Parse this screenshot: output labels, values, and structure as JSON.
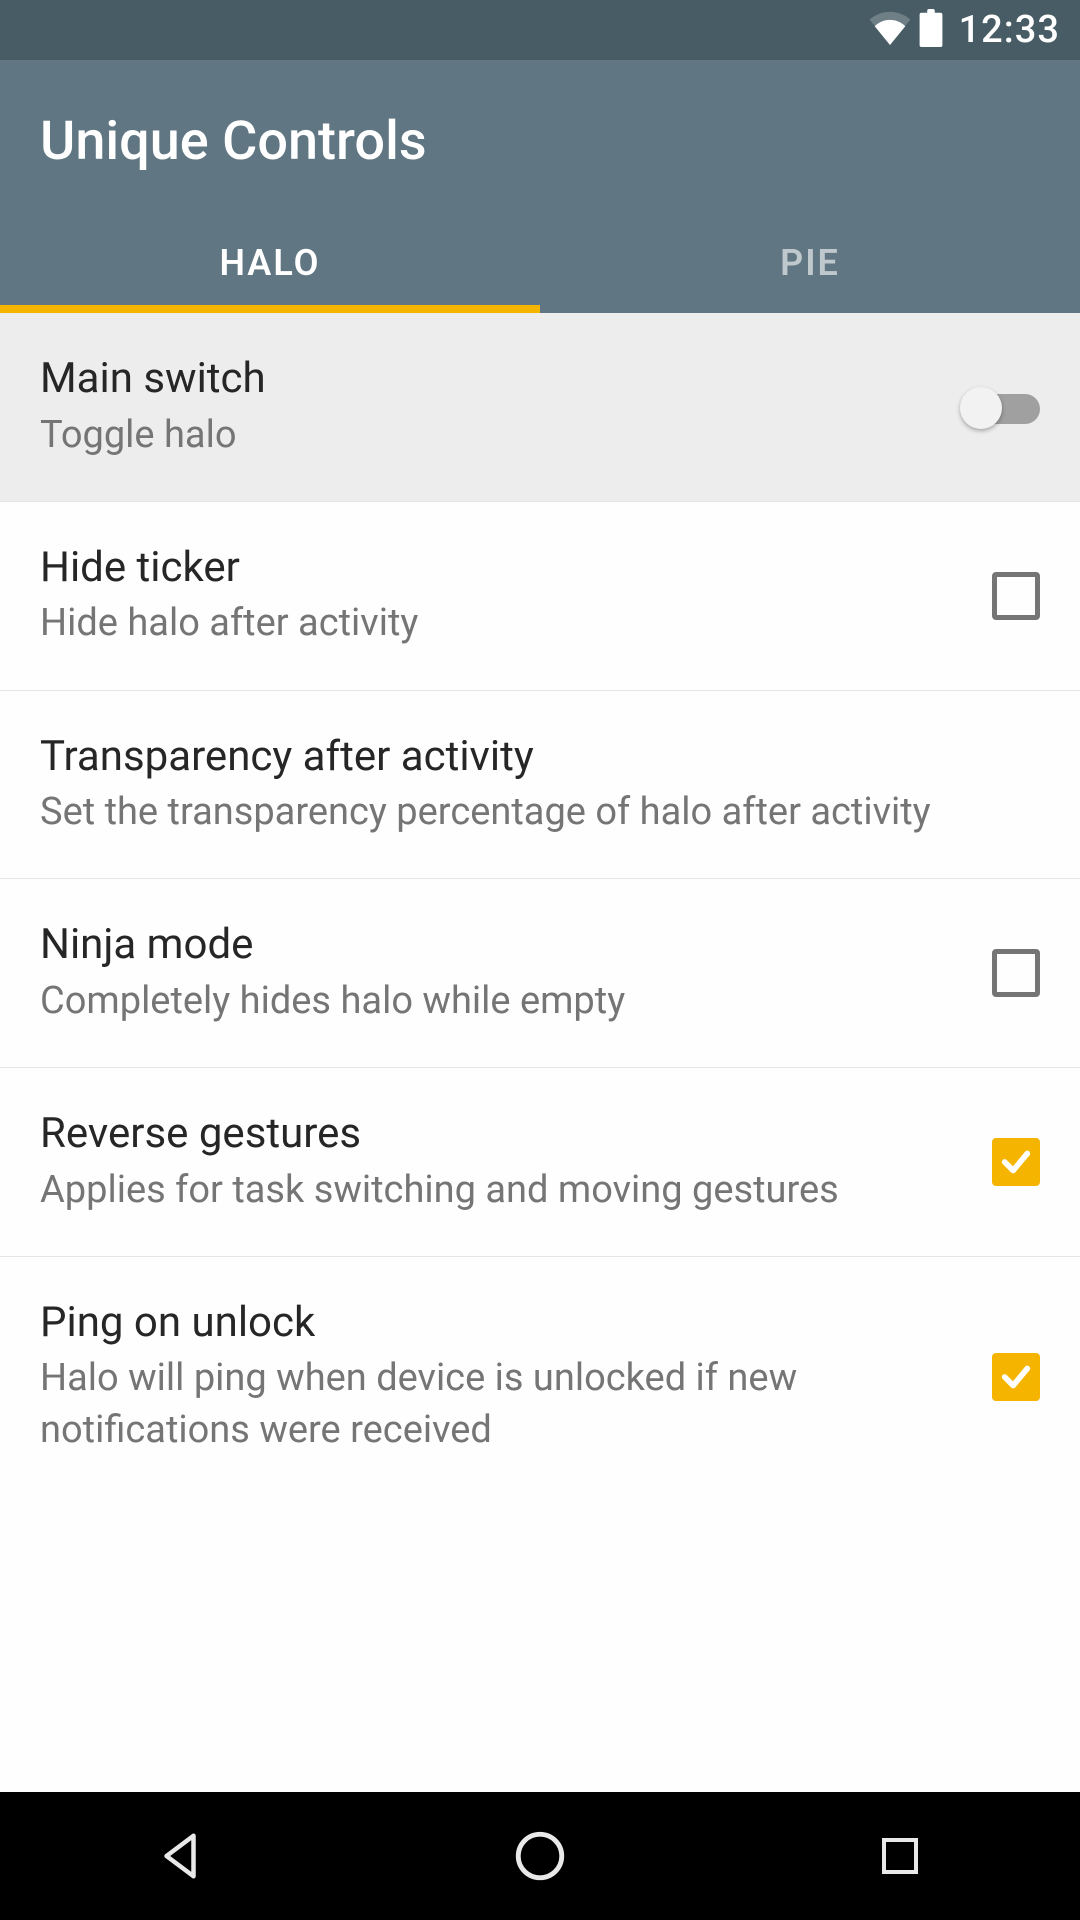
{
  "status": {
    "time": "12:33"
  },
  "header": {
    "title": "Unique Controls"
  },
  "tabs": [
    {
      "label": "HALO",
      "active": true
    },
    {
      "label": "PIE",
      "active": false
    }
  ],
  "settings": [
    {
      "title": "Main switch",
      "sub": "Toggle halo",
      "control": "switch",
      "value": false,
      "grayed": true
    },
    {
      "title": "Hide ticker",
      "sub": "Hide halo after activity",
      "control": "checkbox",
      "value": false
    },
    {
      "title": "Transparency after activity",
      "sub": "Set the transparency percentage of halo after activity",
      "control": "none"
    },
    {
      "title": "Ninja mode",
      "sub": "Completely hides halo while empty",
      "control": "checkbox",
      "value": false
    },
    {
      "title": "Reverse gestures",
      "sub": "Applies for task switching and moving gestures",
      "control": "checkbox",
      "value": true
    },
    {
      "title": "Ping on unlock",
      "sub": "Halo will ping when device is unlocked if new notifications were received",
      "control": "checkbox",
      "value": true
    }
  ],
  "accent": "#f5b400"
}
